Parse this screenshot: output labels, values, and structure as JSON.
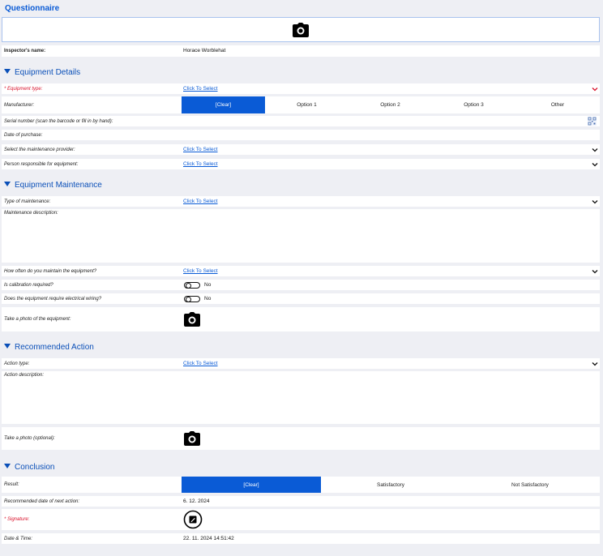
{
  "title": "Questionnaire",
  "inspector": {
    "label": "Inspector's name:",
    "value": "Horace Worblehat"
  },
  "sections": {
    "equipment_details": "Equipment Details",
    "equipment_maintenance": "Equipment Maintenance",
    "recommended_action": "Recommended Action",
    "conclusion": "Conclusion"
  },
  "equipment_details": {
    "equipment_type": {
      "label": "* Equipment type:",
      "value": "Click To Select"
    },
    "manufacturer": {
      "label": "Manufacturer:",
      "options": [
        "[Clear]",
        "Option 1",
        "Option 2",
        "Option 3",
        "Other"
      ],
      "selected_index": 0
    },
    "serial_number": {
      "label": "Serial number (scan the barcode or fill in by hand):",
      "value": ""
    },
    "date_of_purchase": {
      "label": "Date of purchase:",
      "value": ""
    },
    "maintenance_provider": {
      "label": "Select the maintenance provider:",
      "value": "Click To Select"
    },
    "person_responsible": {
      "label": "Person responsible for equipment:",
      "value": "Click To Select"
    }
  },
  "equipment_maintenance": {
    "type_of_maintenance": {
      "label": "Type of maintenance:",
      "value": "Click To Select"
    },
    "maintenance_description": {
      "label": "Maintenance description:",
      "value": ""
    },
    "how_often": {
      "label": "How often do you maintain the equipment?",
      "value": "Click To Select"
    },
    "calibration": {
      "label": "Is calibration required?",
      "value": "No"
    },
    "electrical_wiring": {
      "label": "Does the equipment require electrical wiring?",
      "value": "No"
    },
    "photo": {
      "label": "Take a photo of the equipment:"
    }
  },
  "recommended_action": {
    "action_type": {
      "label": "Action type:",
      "value": "Click To Select"
    },
    "action_description": {
      "label": "Action description:",
      "value": ""
    },
    "photo": {
      "label": "Take a photo (optional):"
    }
  },
  "conclusion": {
    "result": {
      "label": "Result:",
      "options": [
        "[Clear]",
        "Satisfactory",
        "Not Satisfactory"
      ],
      "selected_index": 0
    },
    "next_action_date": {
      "label": "Recommended date of next action:",
      "value": "6. 12. 2024"
    },
    "signature": {
      "label": "* Signature:"
    },
    "date_time": {
      "label": "Date & Time:",
      "value": "22. 11. 2024 14:51:42"
    }
  },
  "colors": {
    "accent": "#0a5bd6",
    "required": "#d9102a",
    "background": "#eeeff4"
  }
}
